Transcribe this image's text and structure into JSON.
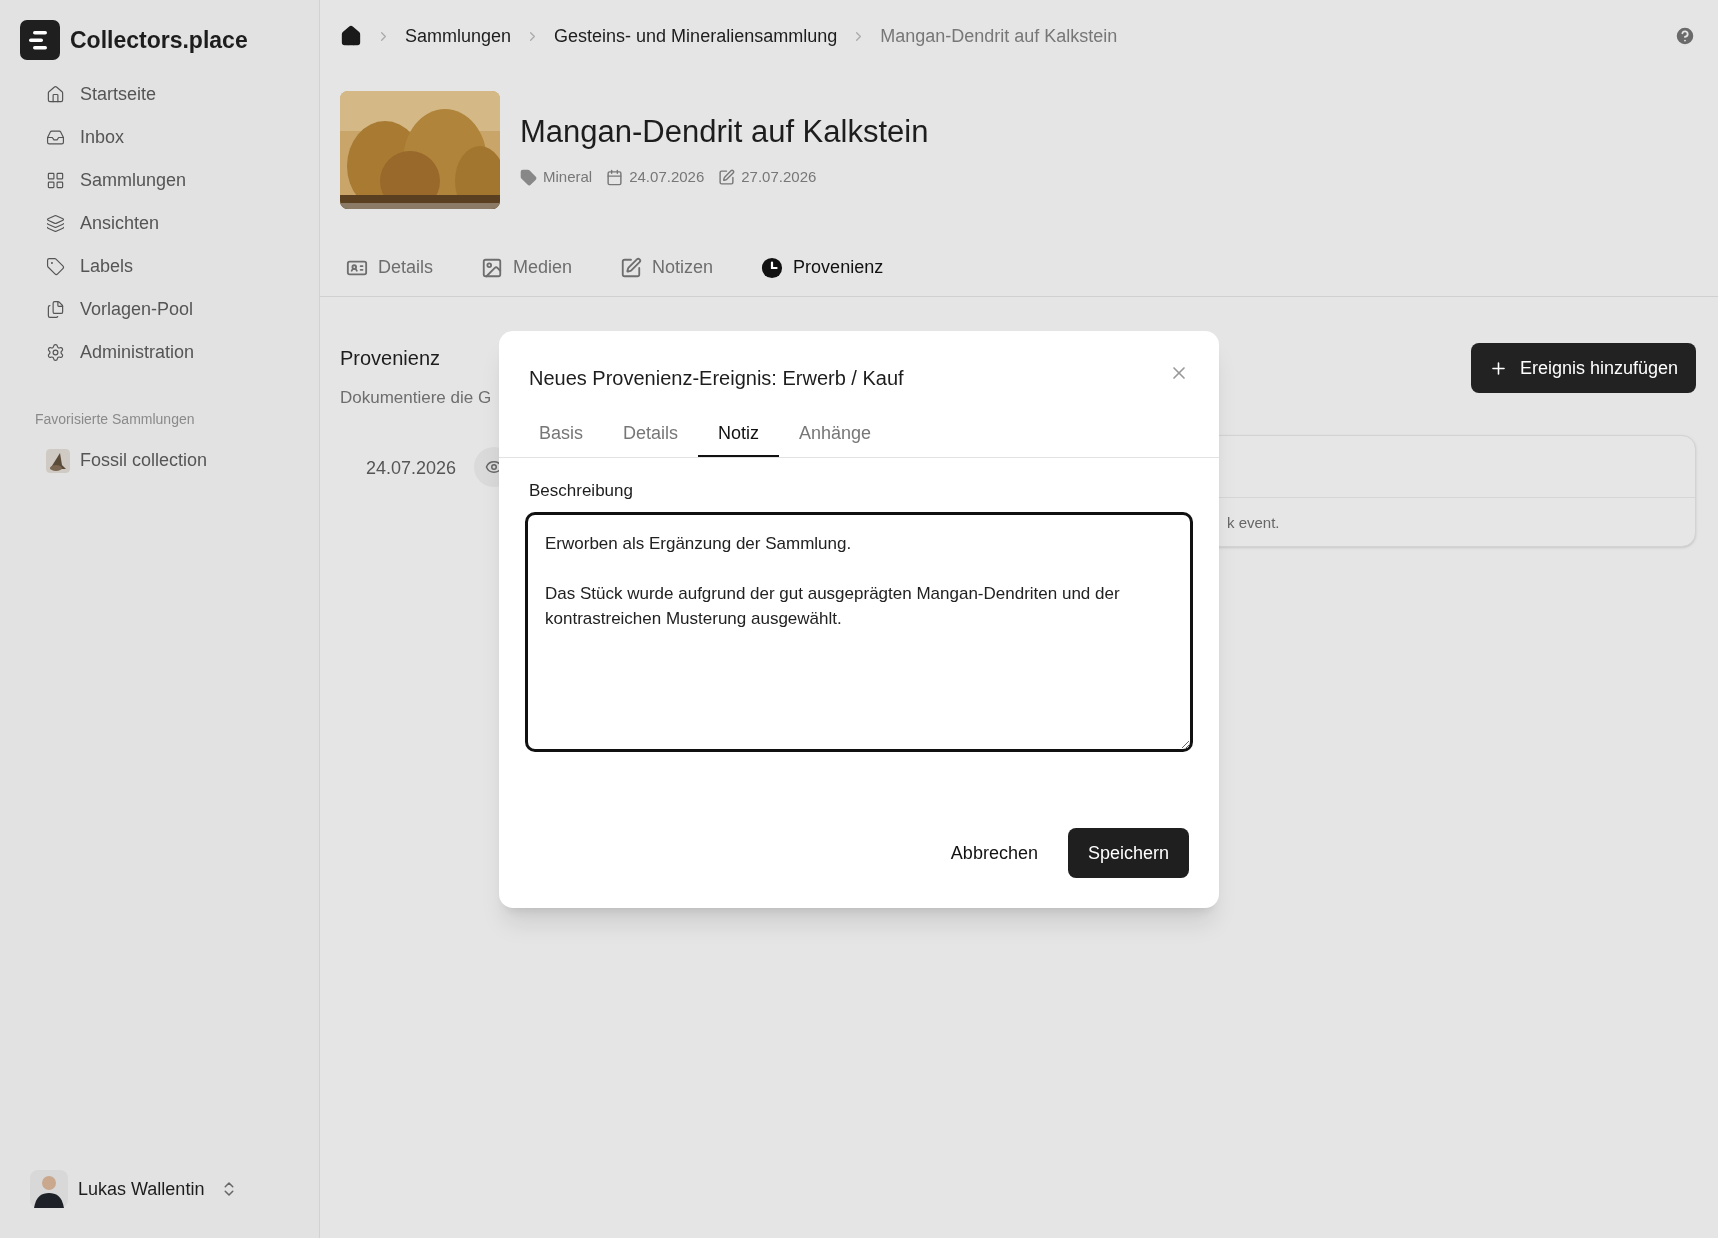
{
  "app": {
    "name": "Collectors.place"
  },
  "sidebar": {
    "items": [
      {
        "label": "Startseite"
      },
      {
        "label": "Inbox"
      },
      {
        "label": "Sammlungen"
      },
      {
        "label": "Ansichten"
      },
      {
        "label": "Labels"
      },
      {
        "label": "Vorlagen-Pool"
      },
      {
        "label": "Administration"
      }
    ]
  },
  "favorites": {
    "heading": "Favorisierte Sammlungen",
    "items": [
      {
        "label": "Fossil collection"
      }
    ]
  },
  "user": {
    "name": "Lukas Wallentin"
  },
  "breadcrumb": [
    "Sammlungen",
    "Gesteins- und Mineraliensammlung",
    "Mangan-Dendrit auf Kalkstein"
  ],
  "item": {
    "title": "Mangan-Dendrit auf Kalkstein",
    "category": "Mineral",
    "created": "24.07.2026",
    "modified": "27.07.2026"
  },
  "tabs": [
    {
      "label": "Details",
      "selected": false
    },
    {
      "label": "Medien",
      "selected": false
    },
    {
      "label": "Notizen",
      "selected": false
    },
    {
      "label": "Provenienz",
      "selected": true
    }
  ],
  "provenance": {
    "heading": "Provenienz",
    "description": "Dokumentiere die G",
    "add_button": "Ereignis hinzufügen",
    "events": [
      {
        "date": "24.07.2026",
        "note": "k event."
      }
    ]
  },
  "dialog": {
    "title": "Neues Provenienz-Ereignis: Erwerb / Kauf",
    "tabs": [
      {
        "label": "Basis",
        "selected": false
      },
      {
        "label": "Details",
        "selected": false
      },
      {
        "label": "Notiz",
        "selected": true
      },
      {
        "label": "Anhänge",
        "selected": false
      }
    ],
    "field_label": "Beschreibung",
    "value": "Erworben als Ergänzung der Sammlung.\n\nDas Stück wurde aufgrund der gut ausgeprägten Mangan-Dendriten und der kontrastreichen Musterung ausgewählt.",
    "cancel": "Abbrechen",
    "save": "Speichern"
  }
}
